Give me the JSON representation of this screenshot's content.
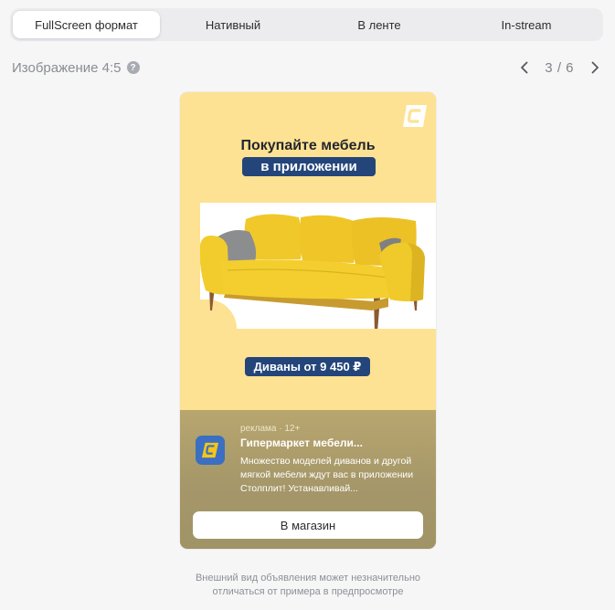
{
  "tabs": [
    {
      "label": "FullScreen формат",
      "active": true
    },
    {
      "label": "Нативный",
      "active": false
    },
    {
      "label": "В ленте",
      "active": false
    },
    {
      "label": "In-stream",
      "active": false
    }
  ],
  "subheader": {
    "title": "Изображение 4:5",
    "help_icon": "question-circle-icon",
    "pager": {
      "current": "3",
      "separator": "/",
      "total": "6"
    }
  },
  "ad": {
    "background_color": "#fde293",
    "accent_color": "#23457a",
    "headline_line1": "Покупайте мебель",
    "headline_line2": "в приложении",
    "price_label": "Диваны от 9 450 ₽",
    "meta": "реклама · 12+",
    "title": "Гипермаркет мебели...",
    "description": "Множество моделей диванов и другой мягкой мебели ждут вас в приложении Столплит! Устанавливай...",
    "cta_label": "В магазин",
    "image": "yellow-sofa-image"
  },
  "disclaimer": {
    "line1": "Внешний вид объявления может незначительно",
    "line2": "отличаться от примера в предпросмотре"
  }
}
